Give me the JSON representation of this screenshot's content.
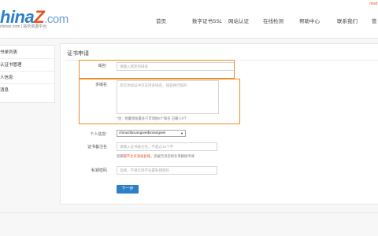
{
  "header": {
    "logo_main": "hina",
    "logo_z": "Z",
    "logo_dotcom": ".com",
    "logo_sub": "chinaz.com | 站长资源平台",
    "top_right": "mod",
    "nav": [
      "首页",
      "数字证书SSL",
      "网站认证",
      "在线检测",
      "帮助中心",
      "联系我们",
      "管"
    ]
  },
  "sidebar": {
    "items": [
      "书单列表",
      "认证书管理",
      "人信息",
      "消息"
    ]
  },
  "main": {
    "title": "证书申请",
    "domain": {
      "label": "域名",
      "placeholder": "请输入绑定的域名"
    },
    "multi_domain": {
      "label": "多域名",
      "placeholder": "您在添加证书可支持多域名，域名换行隔开",
      "hint": "*注：批量添加最多只可添加5个域名 已输入0个"
    },
    "personal_info": {
      "label": "个人信息",
      "value": "chinaz$xxangwei$xxangwei"
    },
    "cert_note": {
      "label": "证书备注名",
      "placeholder": "请输入证书备注名，不超过10个字",
      "hint_prefix": "您都",
      "hint_warn": "都不允许添加此域",
      "hint_suffix": "，您被告诉您将名单删除申请"
    },
    "private_key": {
      "label": "私钥密码",
      "placeholder": "选填，不填写则不设置私钥密码"
    },
    "next_button": "下一步"
  },
  "colors": {
    "brand_blue": "#2d7fc8",
    "accent_orange": "#e8501c",
    "highlight_box": "#f28c28"
  }
}
